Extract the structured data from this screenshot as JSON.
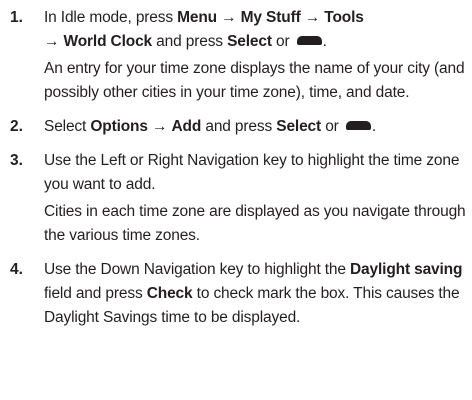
{
  "icons": {
    "soft_key": "left-soft-key-icon"
  },
  "steps": [
    {
      "number": "1.",
      "parts": {
        "t1": "In Idle mode, press ",
        "b1": "Menu",
        "t2": " → ",
        "b2": "My Stuff",
        "t3": " → ",
        "b3": "Tools",
        "t4": " → ",
        "b4": "World Clock",
        "t5": " and press ",
        "b5": "Select",
        "t6": " or ",
        "t7": "."
      },
      "note": "An entry for your time zone displays the name of your city (and possibly other cities in your time zone), time, and date."
    },
    {
      "number": "2.",
      "parts": {
        "t1": "Select ",
        "b1": "Options",
        "t2": " → ",
        "b2": "Add",
        "t3": " and press ",
        "b3": "Select",
        "t4": " or ",
        "t5": "."
      }
    },
    {
      "number": "3.",
      "parts": {
        "t1": "Use the Left or Right Navigation key to highlight the time zone you want to add."
      },
      "note": "Cities in each time zone are displayed as you navigate through the various time zones."
    },
    {
      "number": "4.",
      "parts": {
        "t1": "Use the Down Navigation key to highlight the ",
        "b1": "Daylight saving",
        "t2": " field and press ",
        "b2": "Check",
        "t3": " to check mark the box. This causes the Daylight Savings time to be displayed."
      }
    }
  ]
}
